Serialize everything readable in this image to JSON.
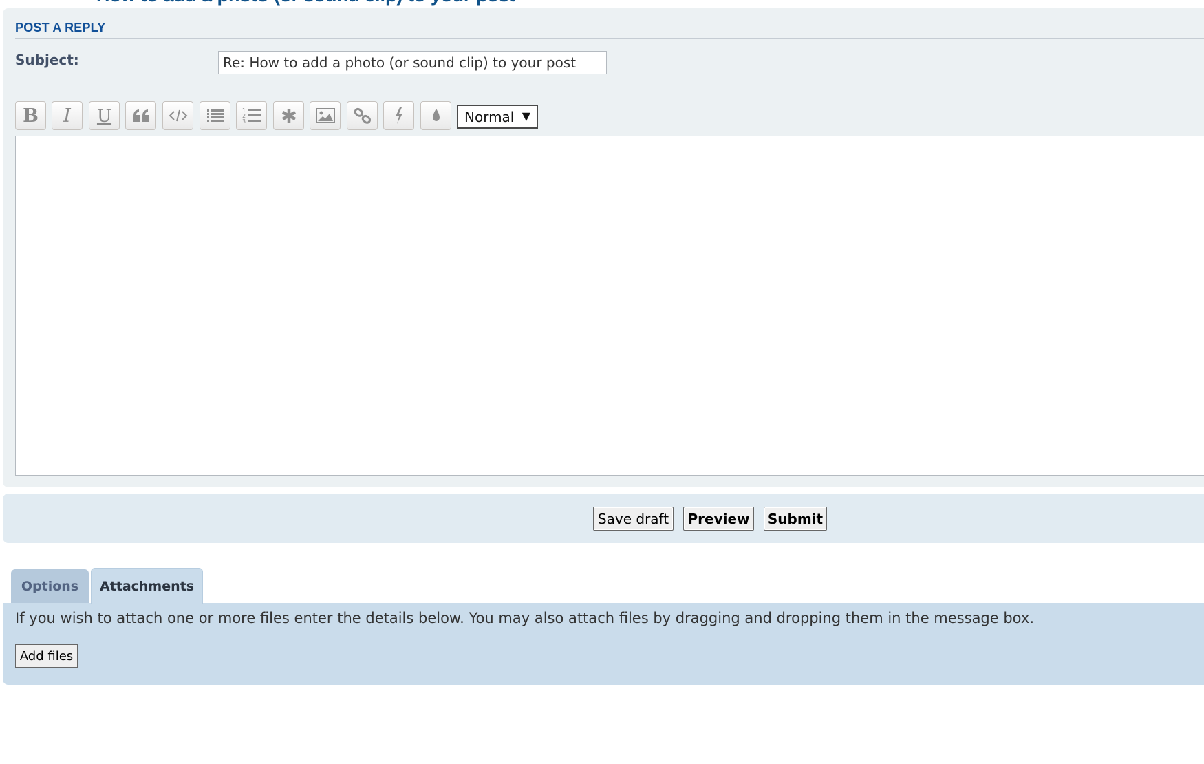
{
  "page": {
    "cut_title": "How to add a photo (or sound clip) to your post"
  },
  "form": {
    "heading": "POST A REPLY",
    "subject_label": "Subject:",
    "subject_value": "Re: How to add a photo (or sound clip) to your post"
  },
  "toolbar": {
    "buttons": [
      {
        "name": "bold-button",
        "glyph": "B"
      },
      {
        "name": "italic-button",
        "glyph": "I"
      },
      {
        "name": "underline-button",
        "glyph": "U"
      },
      {
        "name": "quote-button",
        "icon": "quote-icon"
      },
      {
        "name": "code-button",
        "icon": "code-icon"
      },
      {
        "name": "list-button",
        "icon": "list-icon"
      },
      {
        "name": "ordered-list-button",
        "icon": "ordered-list-icon"
      },
      {
        "name": "list-item-button",
        "icon": "asterisk-icon"
      },
      {
        "name": "image-button",
        "icon": "image-icon"
      },
      {
        "name": "link-button",
        "icon": "link-icon"
      },
      {
        "name": "flash-button",
        "icon": "bolt-icon"
      },
      {
        "name": "color-button",
        "icon": "droplet-icon"
      }
    ],
    "font_size_selected": "Normal",
    "caret": "▼"
  },
  "actions": {
    "save_draft": "Save draft",
    "preview": "Preview",
    "submit": "Submit"
  },
  "tabs": {
    "options": "Options",
    "attachments": "Attachments",
    "active": "attachments"
  },
  "attachments": {
    "help_text": "If you wish to attach one or more files enter the details below. You may also attach files by dragging and dropping them in the message box.",
    "add_files": "Add files"
  },
  "colors": {
    "panel_bg": "#ecf1f3",
    "heading_blue": "#115098",
    "submit_bar_bg": "#e1ebf2",
    "tab_inactive_bg": "#b5c9dc",
    "tab_active_bg": "#cadceb"
  }
}
